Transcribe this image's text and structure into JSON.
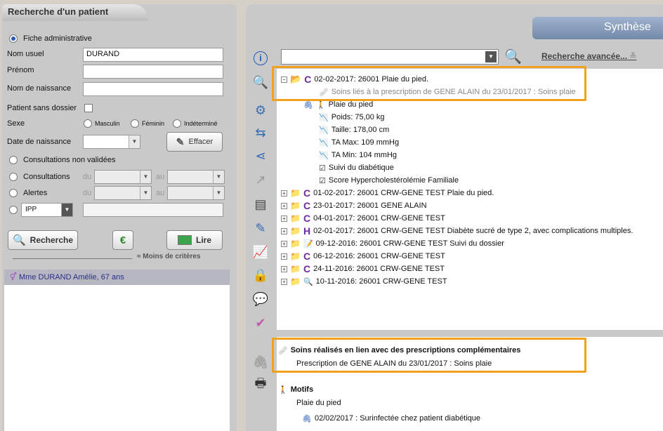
{
  "left": {
    "title": "Recherche d'un patient",
    "fiche_admin": "Fiche administrative",
    "nom_usuel_label": "Nom usuel",
    "nom_usuel_value": "DURAND",
    "prenom_label": "Prénom",
    "nom_naissance_label": "Nom de naissance",
    "sans_dossier_label": "Patient sans dossier",
    "sexe_label": "Sexe",
    "masculin": "Masculin",
    "feminin": "Féminin",
    "indetermine": "Indéterminé",
    "date_naissance_label": "Date de naissance",
    "effacer": "Effacer",
    "consult_non_valid": "Consultations non validées",
    "consultations": "Consultations",
    "alertes": "Alertes",
    "du": "du",
    "au": "au",
    "ipp": "IPP",
    "recherche": "Recherche",
    "lire": "Lire",
    "moins_criteres": "Moins de critères",
    "result": "Mme DURAND Amélie, 67 ans"
  },
  "right": {
    "synthese": "Synthèse",
    "advanced": "Recherche avancée...",
    "tree": [
      {
        "text": "02-02-2017: 26001  Plaie du pied."
      },
      {
        "text": "Soins liés à la prescription de GENE ALAIN du 23/01/2017 : Soins plaie"
      },
      {
        "text": "Plaie du pied"
      },
      {
        "text": "Poids: 75,00 kg"
      },
      {
        "text": "Taille: 178,00 cm"
      },
      {
        "text": "TA Max: 109 mmHg"
      },
      {
        "text": "TA Min: 104 mmHg"
      },
      {
        "text": "Suivi du diabétique"
      },
      {
        "text": "Score Hypercholestérolémie Familiale"
      },
      {
        "text": "01-02-2017: 26001 CRW-GENE TEST Plaie du pied."
      },
      {
        "text": "23-01-2017: 26001 GENE ALAIN"
      },
      {
        "text": "04-01-2017: 26001 CRW-GENE TEST"
      },
      {
        "text": "02-01-2017: 26001 CRW-GENE TEST Diabète sucré de type 2, avec complications multiples."
      },
      {
        "text": "09-12-2016: 26001 CRW-GENE TEST  Suivi du dossier"
      },
      {
        "text": "06-12-2016: 26001 CRW-GENE TEST"
      },
      {
        "text": "24-11-2016: 26001 CRW-GENE TEST"
      },
      {
        "text": "10-11-2016: 26001 CRW-GENE TEST"
      }
    ],
    "detail": {
      "soins_title": "Soins réalisés en lien avec des prescriptions complémentaires",
      "soins_text": "Prescription de GENE ALAIN du 23/01/2017 : Soins plaie",
      "motifs_title": "Motifs",
      "motif": "Plaie du pied",
      "note": "02/02/2017 : Surinfectée chez patient diabétique"
    }
  }
}
